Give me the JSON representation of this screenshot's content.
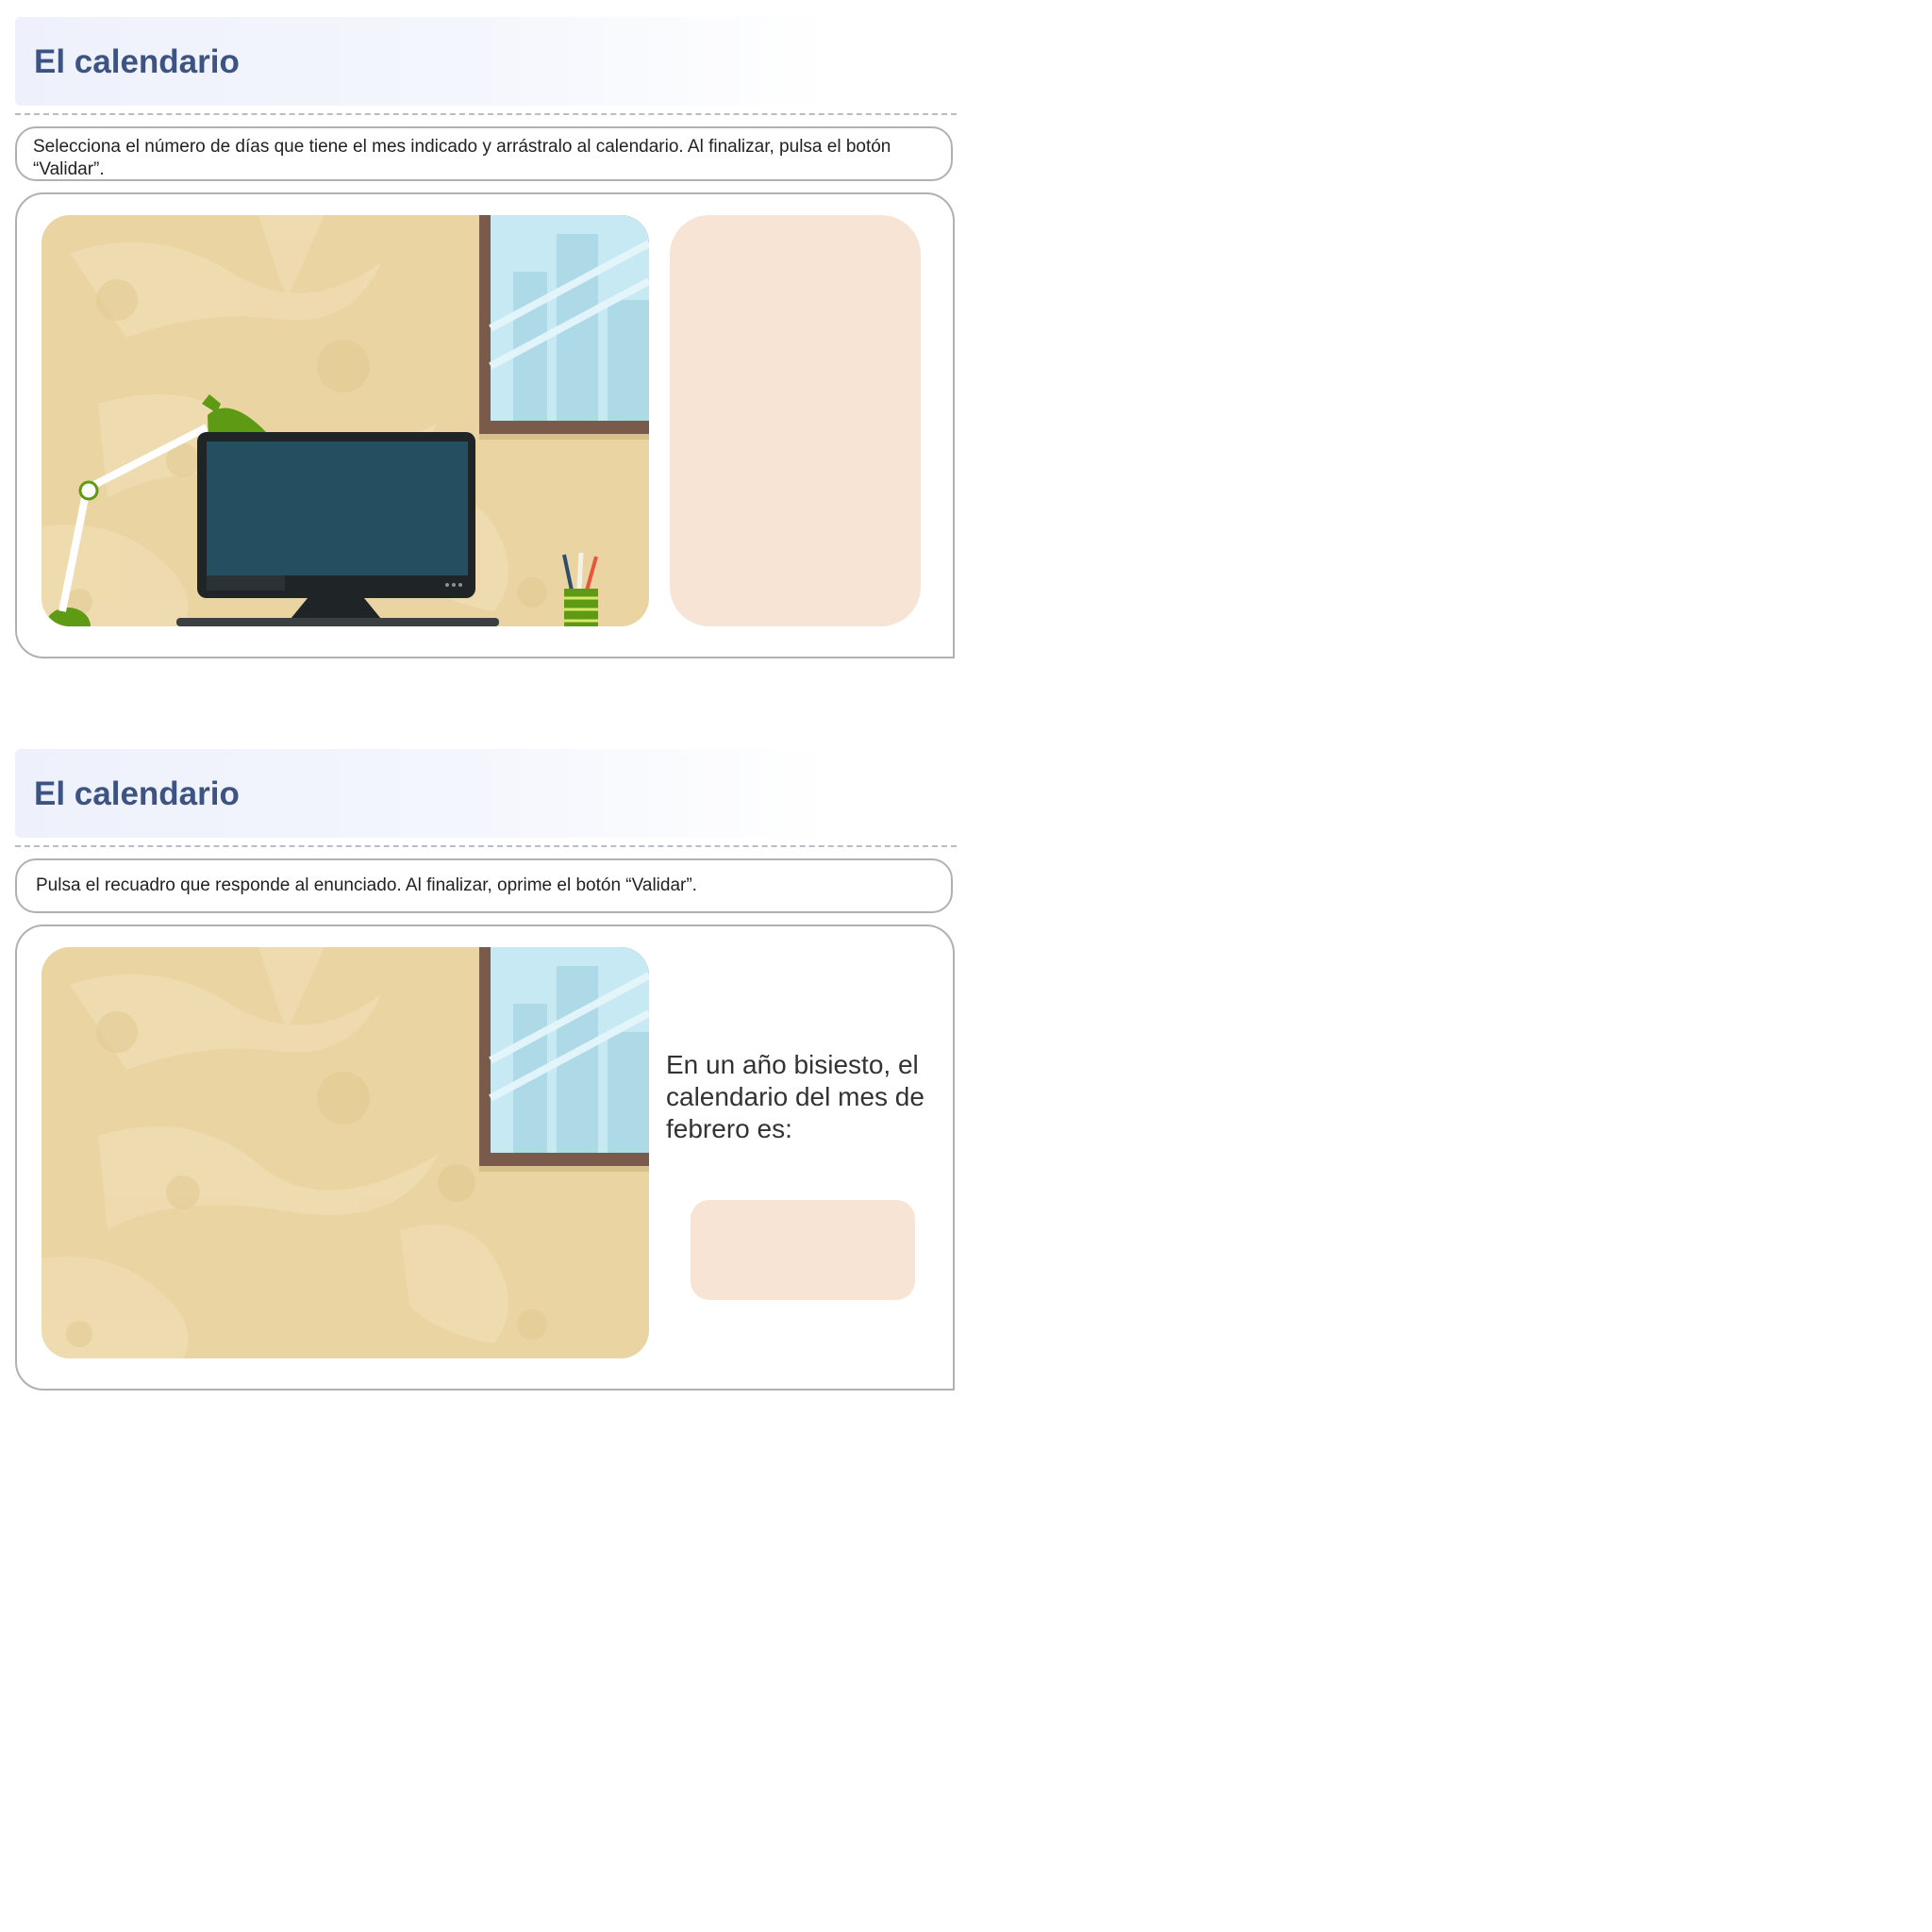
{
  "activities": [
    {
      "title": "El calendario",
      "instruction": "Selecciona el número de días que tiene el mes indicado y arrástralo al calendario. Al finalizar, pulsa el botón “Validar”."
    },
    {
      "title": "El calendario",
      "instruction": "Pulsa el recuadro que responde al enunciado. Al finalizar, oprime el botón “Validar”.",
      "question": "En un año bisiesto, el calendario del mes de febrero es:"
    }
  ],
  "colors": {
    "title": "#3d5482",
    "wall": "#e9d4a2",
    "drop_zone": "#f8e4d4",
    "window_frame": "#7a5a4a",
    "monitor_screen": "#244f61",
    "lamp": "#5e9a14"
  },
  "icons": [
    "desk-lamp-icon",
    "monitor-icon",
    "pencil-cup-icon",
    "window-icon"
  ]
}
